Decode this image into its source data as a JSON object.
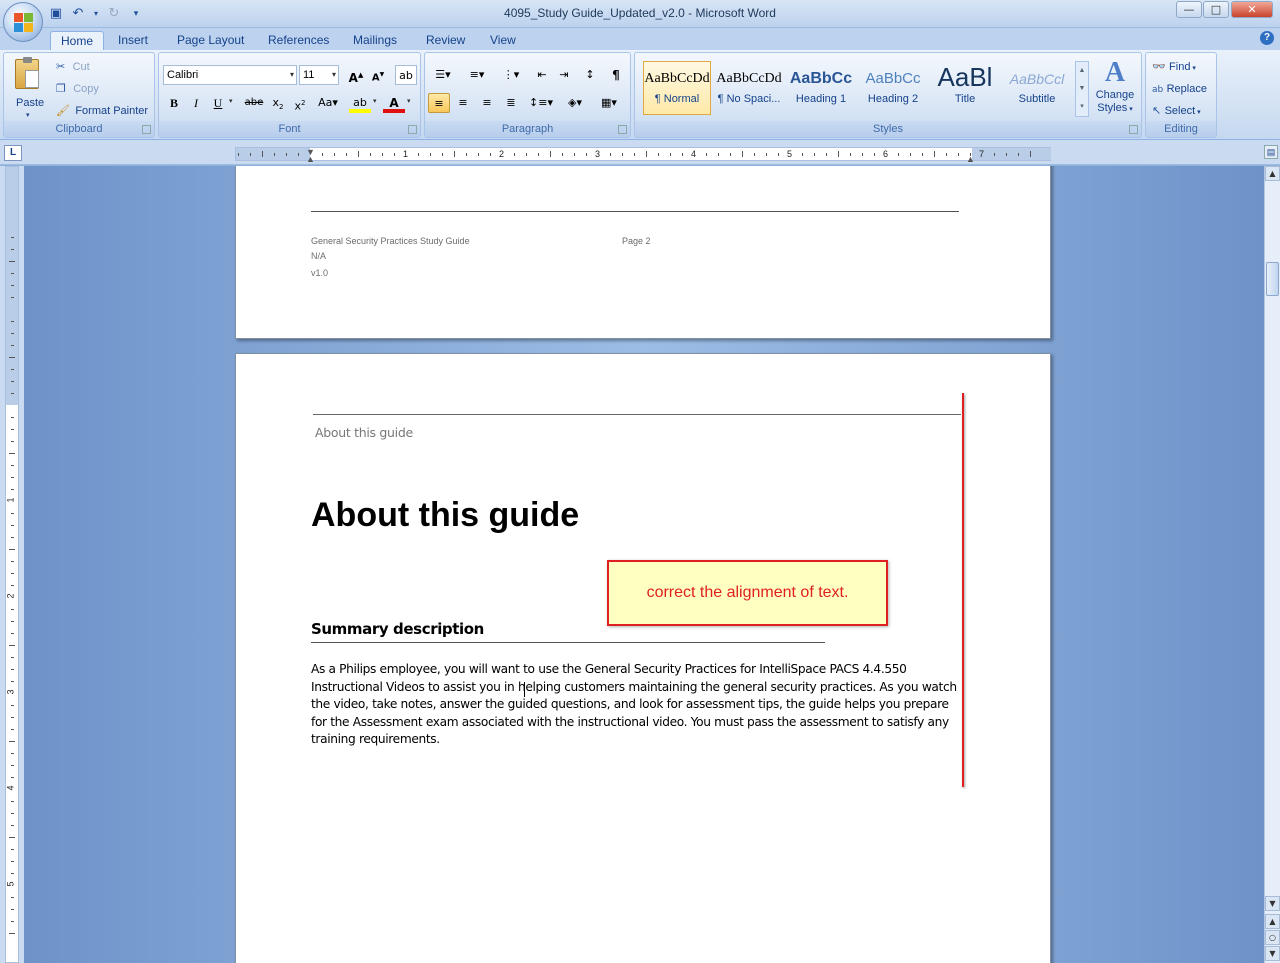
{
  "window": {
    "title": "4095_Study Guide_Updated_v2.0 - Microsoft Word",
    "minimize": "—",
    "maximize": "□",
    "close": "✕"
  },
  "tabs": [
    "Home",
    "Insert",
    "Page Layout",
    "References",
    "Mailings",
    "Review",
    "View"
  ],
  "active_tab": "Home",
  "ribbon": {
    "clipboard": {
      "label": "Clipboard",
      "paste": "Paste",
      "cut": "Cut",
      "copy": "Copy",
      "format_painter": "Format Painter"
    },
    "font": {
      "label": "Font",
      "font_name": "Calibri",
      "font_size": "11"
    },
    "paragraph": {
      "label": "Paragraph"
    },
    "styles": {
      "label": "Styles",
      "items": [
        {
          "preview": "AaBbCcDd",
          "name": "¶ Normal"
        },
        {
          "preview": "AaBbCcDd",
          "name": "¶ No Spaci..."
        },
        {
          "preview": "AaBbCc",
          "name": "Heading 1"
        },
        {
          "preview": "AaBbCc",
          "name": "Heading 2"
        },
        {
          "preview": "AaBl",
          "name": "Title"
        },
        {
          "preview": "AaBbCcl",
          "name": "Subtitle"
        }
      ],
      "change_styles_line1": "Change",
      "change_styles_line2": "Styles"
    },
    "editing": {
      "label": "Editing",
      "find": "Find",
      "replace": "Replace",
      "select": "Select"
    }
  },
  "ruler": {
    "corner": "L",
    "numbers": [
      "1",
      "2",
      "3",
      "4",
      "5",
      "6",
      "7"
    ],
    "vnumbers": [
      "1",
      "2",
      "3",
      "4",
      "5"
    ]
  },
  "page1_footer": {
    "doc_name": "General Security Practices Study Guide",
    "page": "Page 2",
    "na": "N/A",
    "version": "v1.0"
  },
  "page2": {
    "header_text": "About this guide",
    "heading": "About this guide",
    "subheading": "Summary description",
    "paragraph_lines": [
      "As a Philips employee, you will want to use the General Security Practices for IntelliSpace PACS 4.4.550",
      "Instructional Videos to assist you in helping customers maintaining the general security practices.  As you watch",
      "the video, take notes, answer the guided questions, and look for assessment tips, the guide helps you prepare",
      "for the Assessment exam associated with the instructional video. You must pass the assessment to satisfy any",
      "training requirements."
    ]
  },
  "annotation": {
    "text": "correct the alignment of text.",
    "color": "#e02020"
  }
}
